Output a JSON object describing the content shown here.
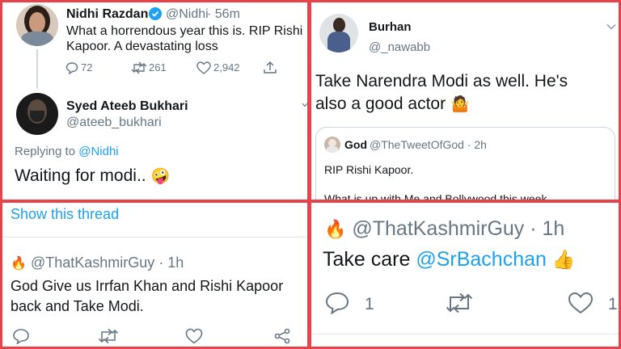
{
  "panel1": {
    "tweet1": {
      "name": "Nidhi Razdan",
      "handle": "@Nidhi",
      "time": "· 56m",
      "text_line1": "What a horrendous year this is. RIP Rishi",
      "text_line2": "Kapoor. A devastating loss",
      "replies": "72",
      "retweets": "261",
      "likes": "2,942"
    },
    "tweet2": {
      "name": "Syed Ateeb Bukhari",
      "handle": "@ateeb_bukhari",
      "replying_prefix": "Replying to",
      "replying_to": "@Nidhi",
      "text": "Waiting for modi..",
      "emoji": "🤪"
    }
  },
  "panel2": {
    "name": "Burhan",
    "handle": "@_nawabb",
    "text_line1": "Take Narendra Modi as well. He's",
    "text_line2": "also a good actor",
    "emoji": "🤷",
    "quoted": {
      "name": "God",
      "handle": "@TheTweetOfGod · 2h",
      "line1": "RIP Rishi Kapoor.",
      "line2": "What is up with Me and Bollywood this week"
    }
  },
  "panel3": {
    "show_thread": "Show this thread",
    "emoji": "🔥",
    "handle": "@ThatKashmirGuy · 1h",
    "text_line1": "God Give us Irrfan Khan and Rishi Kapoor",
    "text_line2": "back and Take Modi."
  },
  "panel4": {
    "emoji": "🔥",
    "handle": "@ThatKashmirGuy · 1h",
    "text_prefix": "Take care",
    "mention": "@SrBachchan",
    "thumb": "👍",
    "replies": "1",
    "likes": "1"
  },
  "colors": {
    "border": "#e8424b",
    "link": "#1da1f2",
    "muted": "#657786",
    "verified": "#1da1f2"
  },
  "icons": [
    "reply-icon",
    "retweet-icon",
    "like-icon",
    "share-icon",
    "verified-icon",
    "chevron-down-icon"
  ]
}
